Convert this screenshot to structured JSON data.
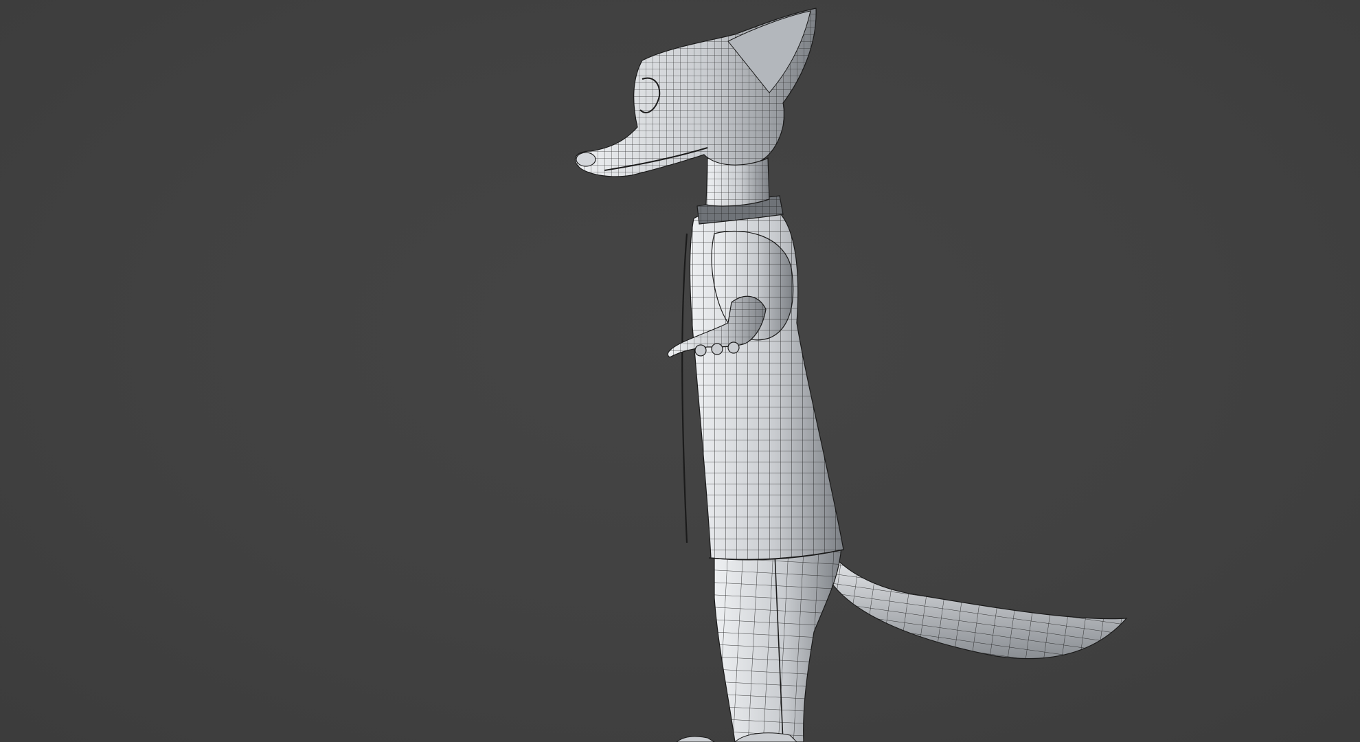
{
  "viewport": {
    "background_color": "#414141",
    "model": {
      "subject": "fox-character-wireframe-model",
      "shading_color": "#c9ccd0",
      "wire_color": "#1b1b1b"
    }
  }
}
